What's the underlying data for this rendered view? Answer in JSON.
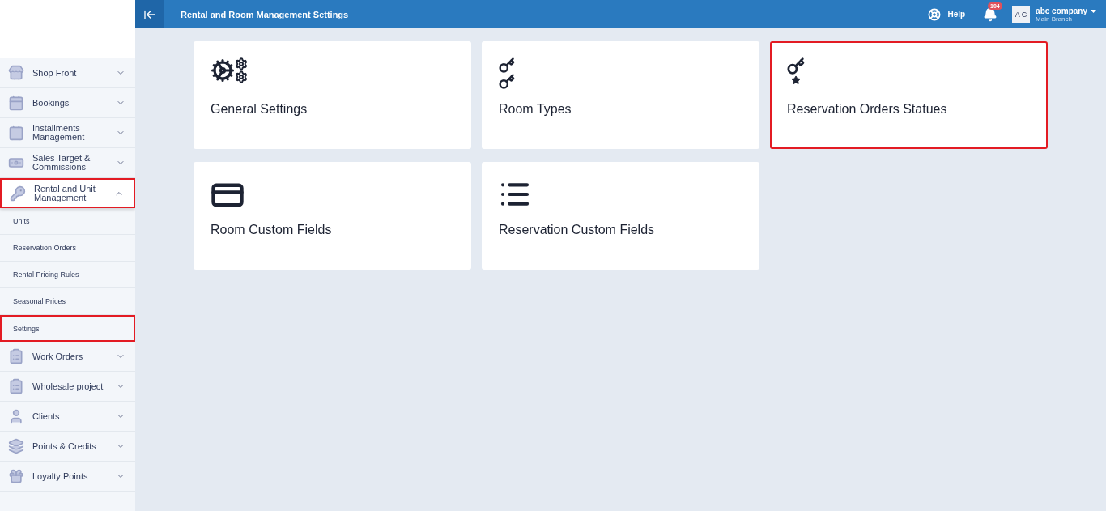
{
  "topbar": {
    "title": "Rental and Room Management Settings",
    "help": "Help",
    "notification_count": "104",
    "avatar": "A C",
    "company": "abc company",
    "branch": "Main Branch"
  },
  "sidebar": {
    "items": [
      {
        "label": "Shop Front",
        "expanded": false,
        "highlighted": false
      },
      {
        "label": "Bookings",
        "expanded": false,
        "highlighted": false
      },
      {
        "label": "Installments Management",
        "expanded": false,
        "highlighted": false
      },
      {
        "label": "Sales Target & Commissions",
        "expanded": false,
        "highlighted": false
      },
      {
        "label": "Rental and Unit Management",
        "expanded": true,
        "highlighted": true,
        "children": [
          {
            "label": "Units",
            "highlighted": false
          },
          {
            "label": "Reservation Orders",
            "highlighted": false
          },
          {
            "label": "Rental Pricing Rules",
            "highlighted": false
          },
          {
            "label": "Seasonal Prices",
            "highlighted": false
          },
          {
            "label": "Settings",
            "highlighted": true
          }
        ]
      },
      {
        "label": "Work Orders",
        "expanded": false,
        "highlighted": false
      },
      {
        "label": "Wholesale project",
        "expanded": false,
        "highlighted": false
      },
      {
        "label": "Clients",
        "expanded": false,
        "highlighted": false
      },
      {
        "label": "Points & Credits",
        "expanded": false,
        "highlighted": false
      },
      {
        "label": "Loyalty Points",
        "expanded": false,
        "highlighted": false
      }
    ]
  },
  "cards": [
    {
      "label": "General Settings",
      "highlighted": false
    },
    {
      "label": "Room Types",
      "highlighted": false
    },
    {
      "label": "Reservation Orders Statues",
      "highlighted": true
    },
    {
      "label": "Room Custom Fields",
      "highlighted": false
    },
    {
      "label": "Reservation Custom Fields",
      "highlighted": false
    }
  ]
}
